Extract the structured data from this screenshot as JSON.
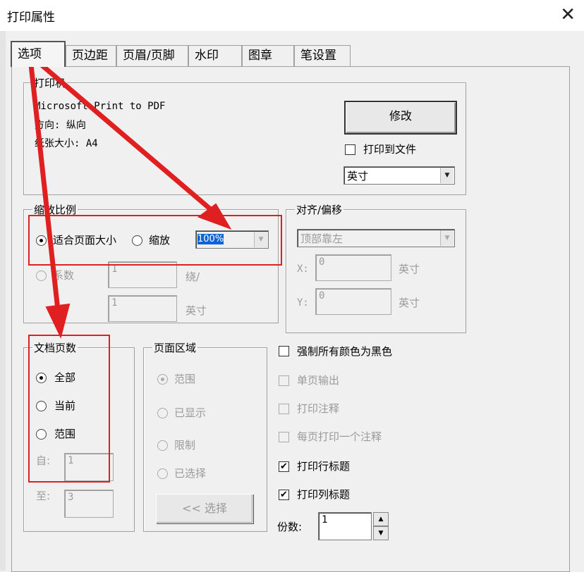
{
  "window": {
    "title": "打印属性",
    "close_glyph": "✕"
  },
  "tabs": [
    {
      "label": "选项",
      "active": true
    },
    {
      "label": "页边距"
    },
    {
      "label": "页眉/页脚"
    },
    {
      "label": "水印"
    },
    {
      "label": "图章"
    },
    {
      "label": "笔设置"
    }
  ],
  "printer": {
    "legend": "打印机",
    "name": "Microsoft Print to PDF",
    "orientation": "方向: 纵向",
    "paper": "纸张大小: A4",
    "modify_label": "修改",
    "print_to_file_label": "打印到文件",
    "units_value": "英寸"
  },
  "scale": {
    "legend": "缩放比例",
    "fit_page_label": "适合页面大小",
    "zoom_label": "缩放",
    "zoom_value": "100%",
    "factor_label": "系数",
    "factor_value": "1",
    "per_label": "绕/",
    "inch_value": "1",
    "inch_label": "英寸"
  },
  "align": {
    "legend": "对齐/偏移",
    "position_value": "顶部靠左",
    "x_label": "X:",
    "x_value": "0",
    "x_unit": "英寸",
    "y_label": "Y:",
    "y_value": "0",
    "y_unit": "英寸"
  },
  "doc_pages": {
    "legend": "文档页数",
    "all_label": "全部",
    "current_label": "当前",
    "range_label": "范围",
    "from_label": "自:",
    "from_value": "1",
    "to_label": "至:",
    "to_value": "3"
  },
  "page_area": {
    "legend": "页面区域",
    "range_label": "范围",
    "displayed_label": "已显示",
    "limit_label": "限制",
    "selected_label": "已选择",
    "select_button_label": "<< 选择"
  },
  "options": {
    "force_black_label": "强制所有颜色为黑色",
    "single_page_label": "单页输出",
    "print_notes_label": "打印注释",
    "one_note_per_page_label": "每页打印一个注释",
    "print_row_titles_label": "打印行标题",
    "print_col_titles_label": "打印列标题",
    "copies_label": "份数:",
    "copies_value": "1",
    "check_glyph": "✔"
  },
  "spinner": {
    "up": "▲",
    "down": "▼"
  },
  "dropdown_glyph": "▼",
  "colors": {
    "annotation_red": "#e02020",
    "highlight_blue": "#0a64d8"
  }
}
